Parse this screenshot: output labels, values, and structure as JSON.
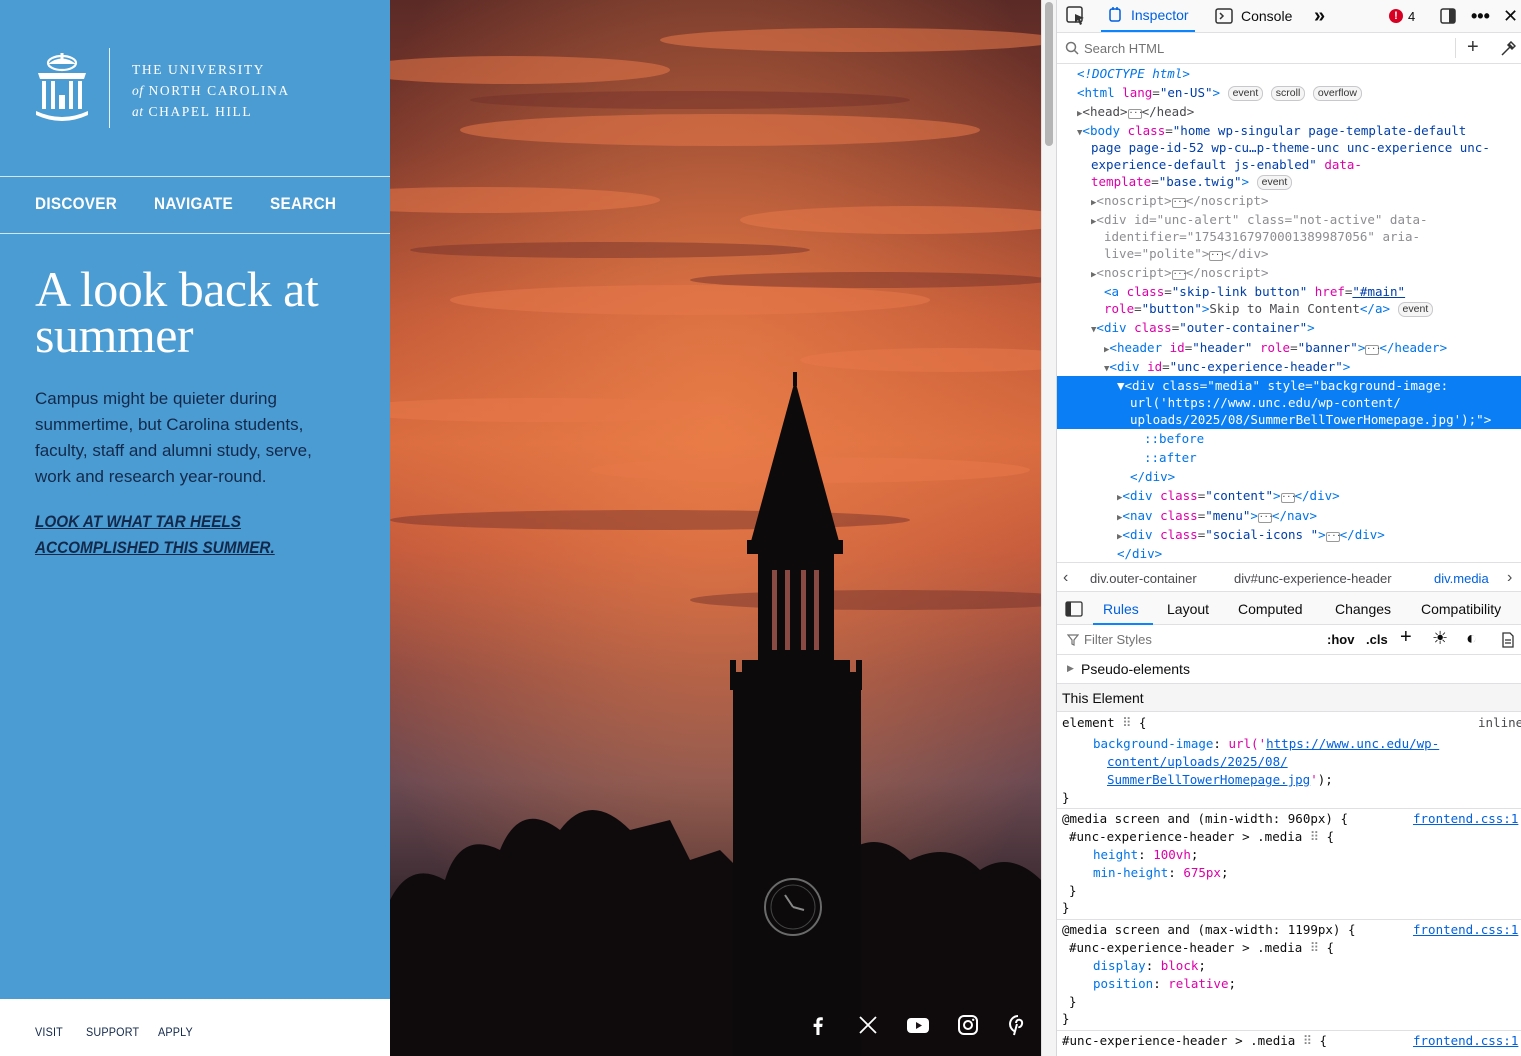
{
  "site": {
    "logo_line1": "THE UNIVERSITY",
    "logo_line2_em": "of",
    "logo_line2": "NORTH CAROLINA",
    "logo_line3_em": "at",
    "logo_line3": "CHAPEL HILL",
    "nav": [
      "DISCOVER",
      "NAVIGATE",
      "SEARCH"
    ],
    "hero_title": "A look back at summer",
    "hero_body": "Campus might be quieter during summertime, but Carolina students, faculty, staff and alumni study, serve, work and research year-round.",
    "hero_link": "LOOK AT WHAT TAR HEELS ACCOMPLISHED THIS SUMMER.",
    "footer_links": [
      "VISIT",
      "SUPPORT",
      "APPLY"
    ],
    "social_icons": [
      "facebook-icon",
      "x-icon",
      "youtube-icon",
      "instagram-icon",
      "pinterest-icon"
    ],
    "colors": {
      "carolina_blue": "#4b9cd3",
      "navy": "#13294b"
    }
  },
  "devtools": {
    "tabs": {
      "inspector": "Inspector",
      "console": "Console",
      "error_count": "4"
    },
    "search_placeholder": "Search HTML",
    "breadcrumbs": [
      "div.outer-container",
      "div#unc-experience-header",
      "div.media"
    ],
    "rule_tabs": [
      "Rules",
      "Layout",
      "Computed",
      "Changes",
      "Compatibility"
    ],
    "filter_placeholder": "Filter Styles",
    "hov": ":hov",
    "cls": ".cls",
    "pseudo_elements": "Pseudo-elements",
    "this_element": "This Element",
    "element_source": "inline",
    "rule_source": "frontend.css:1"
  }
}
